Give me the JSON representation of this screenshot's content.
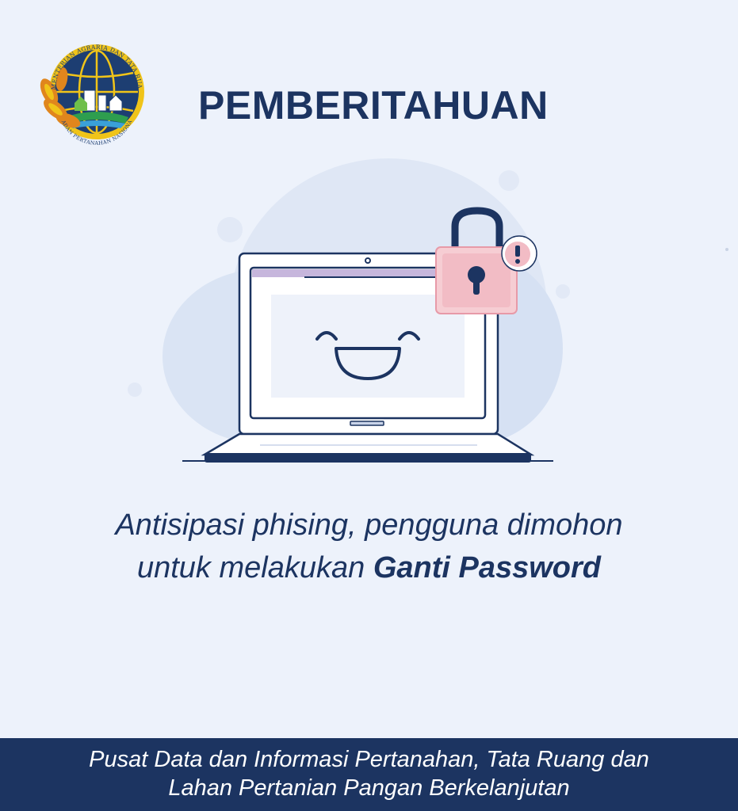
{
  "logo": {
    "top_text": "KEMENTERIAN AGRARIA DAN TATA RUANG",
    "bottom_text": "BADAN PERTANAHAN NASIONAL"
  },
  "header": {
    "title": "PEMBERITAHUAN"
  },
  "illustration": {
    "icons": [
      "laptop-icon",
      "smiley-face-icon",
      "padlock-icon",
      "exclamation-icon"
    ],
    "colors": {
      "navy": "#1c3461",
      "padlock": "#f2c4cc",
      "screen_bar": "#c6b6dc",
      "blob": "#dce6f5"
    }
  },
  "message": {
    "line1": "Antisipasi phising, pengguna dimohon",
    "line2_prefix": "untuk melakukan ",
    "line2_bold": "Ganti Password"
  },
  "footer": {
    "line1": "Pusat Data dan Informasi Pertanahan, Tata Ruang dan",
    "line2": "Lahan Pertanian Pangan Berkelanjutan"
  }
}
